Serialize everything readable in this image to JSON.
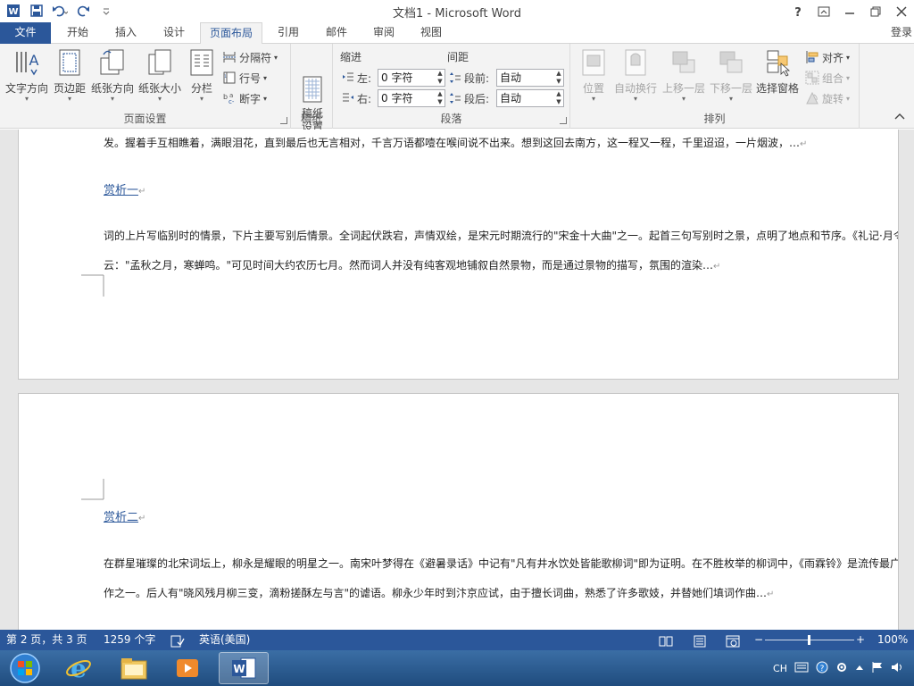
{
  "window": {
    "title": "文档1 - Microsoft Word"
  },
  "qat": {
    "icons": [
      "word-logo-icon",
      "save-icon",
      "undo-icon",
      "redo-icon",
      "customize-icon"
    ]
  },
  "tabs": [
    {
      "label": "文件"
    },
    {
      "label": "开始"
    },
    {
      "label": "插入"
    },
    {
      "label": "设计"
    },
    {
      "label": "页面布局"
    },
    {
      "label": "引用"
    },
    {
      "label": "邮件"
    },
    {
      "label": "审阅"
    },
    {
      "label": "视图"
    }
  ],
  "login_label": "登录",
  "ribbon": {
    "page_setup": {
      "label": "页面设置",
      "text_direction": "文字方向",
      "margins": "页边距",
      "orientation": "纸张方向",
      "size": "纸张大小",
      "columns": "分栏",
      "breaks": "分隔符",
      "line_numbers": "行号",
      "hyphenation": "断字"
    },
    "paper": {
      "label": "稿纸",
      "draft_setup": "稿纸\n设置"
    },
    "paragraph": {
      "label": "段落",
      "indent_header": "缩进",
      "spacing_header": "间距",
      "left_label": "左:",
      "left_value": "0 字符",
      "right_label": "右:",
      "right_value": "0 字符",
      "before_label": "段前:",
      "before_value": "自动",
      "after_label": "段后:",
      "after_value": "自动"
    },
    "arrange": {
      "label": "排列",
      "position": "位置",
      "wrap_text": "自动换行",
      "bring_forward": "上移一层",
      "send_backward": "下移一层",
      "selection_pane": "选择窗格",
      "align": "对齐",
      "group": "组合",
      "rotate": "旋转"
    }
  },
  "document": {
    "page1": {
      "line1": "发。握着手互相瞧着，满眼泪花，直到最后也无言相对，千言万语都噎在喉间说不出来。想到这回去南方，这一程又一程，千里迢迢，一片烟波，…",
      "heading": "赏析一",
      "line2": "词的上片写临别时的情景，下片主要写别后情景。全词起伏跌宕，声情双绘，是宋元时期流行的\"宋金十大曲\"之一。起首三句写别时之景，点明了地点和节序。《礼记·月令",
      "line3": "云：\"孟秋之月，寒蝉鸣。\"可见时间大约农历七月。然而词人并没有纯客观地铺叙自然景物，而是通过景物的描写，氛围的渲染…"
    },
    "page2": {
      "heading": "赏析二",
      "line1": "在群星璀璨的北宋词坛上，柳永是耀眼的明星之一。南宋叶梦得在《避暑录话》中记有\"凡有井水饮处皆能歌柳词\"即为证明。在不胜枚举的柳词中，《雨霖铃》是流传最广",
      "line2": "作之一。后人有\"晓风残月柳三变，滴粉搓酥左与言\"的谑语。柳永少年时到汴京应试，由于擅长词曲，熟悉了许多歌妓，并替她们填词作曲…"
    },
    "para_mark": "↵"
  },
  "statusbar": {
    "page_info": "第 2 页，共 3 页",
    "word_count": "1259 个字",
    "language": "英语(美国)",
    "zoom_minus": "−",
    "zoom_plus": "+",
    "zoom": "100%"
  },
  "taskbar": {
    "tray_lang": "CH"
  },
  "colors": {
    "accent": "#2b579a",
    "ribbon_bg": "#f3f3f3",
    "doc_bg": "#e6e6e6"
  }
}
